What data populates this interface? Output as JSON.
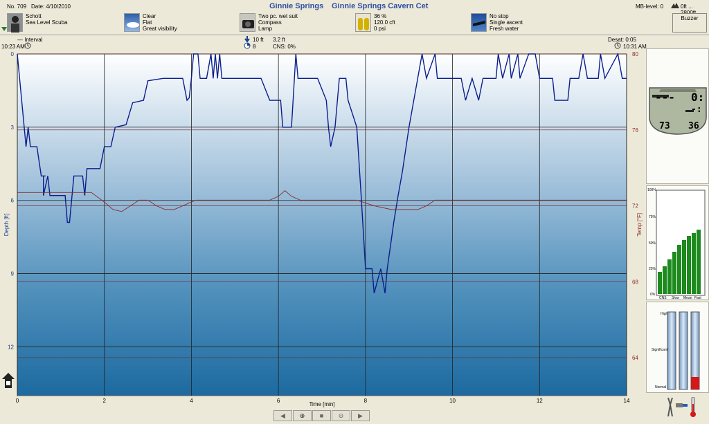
{
  "header": {
    "dive_no": "No. 709",
    "date": "Date: 4/10/2010",
    "site": "Ginnie Springs",
    "site_detail": "Ginnie Springs Cavern Cet",
    "mb_level": "MB-level: 0",
    "altitude": "0ft ... 2800ft"
  },
  "info": {
    "diver": [
      "Schott",
      "Sea Level Scuba"
    ],
    "conditions": [
      "Clear",
      "Flat",
      "Great visibility"
    ],
    "equipment": [
      "Two pc. wet suit",
      "Compass",
      "Lamp"
    ],
    "gas": [
      "36 %",
      "120.0 cft",
      "0 psi"
    ],
    "dive_type": [
      "No stop",
      "Single ascent",
      "Fresh water"
    ]
  },
  "buzzer_label": "Buzzer",
  "stats": {
    "interval_label": "--- Interval",
    "start_time": "10:23 AM",
    "max_depth": "10 ft",
    "avg_depth": "3.2 ft",
    "dive_time": "8",
    "cns": "CNS:  0%",
    "desat": "Desat:  0:05",
    "end_time": "10:31 AM"
  },
  "computer_display": {
    "temp": "73",
    "o2": "36",
    "top_left": "---",
    "top_right": "0:",
    "mid_right": "-:"
  },
  "tissue_chart": {
    "y_labels": [
      "100%",
      "75%",
      "50%",
      "25%",
      "0%"
    ],
    "x_labels": [
      "CNS",
      "Slow",
      "Mean",
      "Fast"
    ]
  },
  "gauges": {
    "labels": [
      "High",
      "Significant",
      "Normal"
    ]
  },
  "nav": {
    "prev": "◀",
    "zoom_in": "⊕",
    "stop": "■",
    "zoom_out": "⊖",
    "next": "▶"
  },
  "chart_data": {
    "type": "line",
    "xlabel": "Time [min]",
    "ylabel": "Depth [ft]",
    "y2label": "Temp [°F]",
    "xlim": [
      0,
      14
    ],
    "ylim": [
      0,
      14
    ],
    "y2lim": [
      62,
      80
    ],
    "x_ticks": [
      0,
      2,
      4,
      6,
      8,
      10,
      12,
      14
    ],
    "y_ticks": [
      0,
      3,
      6,
      9,
      12
    ],
    "y2_ticks": [
      80,
      76,
      72,
      68,
      64
    ],
    "grid": true,
    "series": [
      {
        "axis": "depth",
        "color": "#0b1e8c",
        "points": [
          [
            0.0,
            0.0
          ],
          [
            0.2,
            3.8
          ],
          [
            0.25,
            3.0
          ],
          [
            0.3,
            3.8
          ],
          [
            0.45,
            3.8
          ],
          [
            0.55,
            5.0
          ],
          [
            0.65,
            5.0
          ],
          [
            0.6,
            5.0
          ],
          [
            0.6,
            5.8
          ],
          [
            0.7,
            5.0
          ],
          [
            0.75,
            5.8
          ],
          [
            1.1,
            5.8
          ],
          [
            1.15,
            6.9
          ],
          [
            1.2,
            6.9
          ],
          [
            1.3,
            5.0
          ],
          [
            1.5,
            5.0
          ],
          [
            1.55,
            5.8
          ],
          [
            1.6,
            4.7
          ],
          [
            1.9,
            4.7
          ],
          [
            2.0,
            3.8
          ],
          [
            2.15,
            3.8
          ],
          [
            2.25,
            3.0
          ],
          [
            2.5,
            2.9
          ],
          [
            2.65,
            2.0
          ],
          [
            2.9,
            1.9
          ],
          [
            3.0,
            1.1
          ],
          [
            3.35,
            1.0
          ],
          [
            3.8,
            1.0
          ],
          [
            3.9,
            1.9
          ],
          [
            3.95,
            1.8
          ],
          [
            4.0,
            1.0
          ],
          [
            4.05,
            0.0
          ],
          [
            4.15,
            0.0
          ],
          [
            4.2,
            1.0
          ],
          [
            4.35,
            1.0
          ],
          [
            4.45,
            0.0
          ],
          [
            4.5,
            1.0
          ],
          [
            4.55,
            0.0
          ],
          [
            4.6,
            1.0
          ],
          [
            4.65,
            0.0
          ],
          [
            4.7,
            1.0
          ],
          [
            5.6,
            1.0
          ],
          [
            5.8,
            1.9
          ],
          [
            6.05,
            1.9
          ],
          [
            6.1,
            3.0
          ],
          [
            6.3,
            3.0
          ],
          [
            6.4,
            0.0
          ],
          [
            6.45,
            1.0
          ],
          [
            6.9,
            1.0
          ],
          [
            7.1,
            1.9
          ],
          [
            7.15,
            3.0
          ],
          [
            7.2,
            3.8
          ],
          [
            7.3,
            3.0
          ],
          [
            7.4,
            1.0
          ],
          [
            7.55,
            1.0
          ],
          [
            7.6,
            1.9
          ],
          [
            7.8,
            3.0
          ],
          [
            7.9,
            5.8
          ],
          [
            8.0,
            8.8
          ],
          [
            8.15,
            8.8
          ],
          [
            8.2,
            9.8
          ],
          [
            8.35,
            8.8
          ],
          [
            8.45,
            9.8
          ],
          [
            8.5,
            8.8
          ],
          [
            8.65,
            6.9
          ],
          [
            8.75,
            5.8
          ],
          [
            8.85,
            4.8
          ],
          [
            9.0,
            3.0
          ],
          [
            9.2,
            1.0
          ],
          [
            9.3,
            0.0
          ],
          [
            9.4,
            1.0
          ],
          [
            9.6,
            0.0
          ],
          [
            9.65,
            1.0
          ],
          [
            10.2,
            1.0
          ],
          [
            10.3,
            1.9
          ],
          [
            10.45,
            1.0
          ],
          [
            10.6,
            1.9
          ],
          [
            10.7,
            1.0
          ],
          [
            11.0,
            1.0
          ],
          [
            11.05,
            0.0
          ],
          [
            11.15,
            1.0
          ],
          [
            11.3,
            0.0
          ],
          [
            11.35,
            1.0
          ],
          [
            11.5,
            0.0
          ],
          [
            11.55,
            1.0
          ],
          [
            11.75,
            0.0
          ],
          [
            11.9,
            0.0
          ],
          [
            12.0,
            1.0
          ],
          [
            12.3,
            1.0
          ],
          [
            12.35,
            1.9
          ],
          [
            12.65,
            1.9
          ],
          [
            12.7,
            1.0
          ],
          [
            12.9,
            1.0
          ],
          [
            13.0,
            0.0
          ],
          [
            13.1,
            1.0
          ],
          [
            13.35,
            1.0
          ],
          [
            13.4,
            0.0
          ],
          [
            13.5,
            1.0
          ],
          [
            13.8,
            0.0
          ],
          [
            13.9,
            1.0
          ],
          [
            14.0,
            1.0
          ]
        ]
      },
      {
        "axis": "temp",
        "color": "#8b2b2b",
        "points": [
          [
            0.0,
            72.7
          ],
          [
            1.7,
            72.7
          ],
          [
            2.0,
            72.2
          ],
          [
            2.2,
            71.8
          ],
          [
            2.4,
            71.7
          ],
          [
            2.6,
            72.0
          ],
          [
            2.8,
            72.3
          ],
          [
            3.0,
            72.3
          ],
          [
            3.2,
            72.0
          ],
          [
            3.4,
            71.8
          ],
          [
            3.6,
            71.8
          ],
          [
            3.8,
            72.0
          ],
          [
            4.1,
            72.3
          ],
          [
            4.5,
            72.3
          ],
          [
            5.4,
            72.3
          ],
          [
            5.8,
            72.3
          ],
          [
            6.0,
            72.5
          ],
          [
            6.15,
            72.8
          ],
          [
            6.3,
            72.5
          ],
          [
            6.5,
            72.3
          ],
          [
            7.8,
            72.3
          ],
          [
            8.2,
            72.0
          ],
          [
            8.6,
            71.8
          ],
          [
            9.2,
            71.8
          ],
          [
            9.4,
            72.0
          ],
          [
            9.6,
            72.3
          ],
          [
            10.0,
            72.3
          ],
          [
            12.0,
            72.3
          ],
          [
            14.0,
            72.3
          ]
        ]
      }
    ]
  }
}
